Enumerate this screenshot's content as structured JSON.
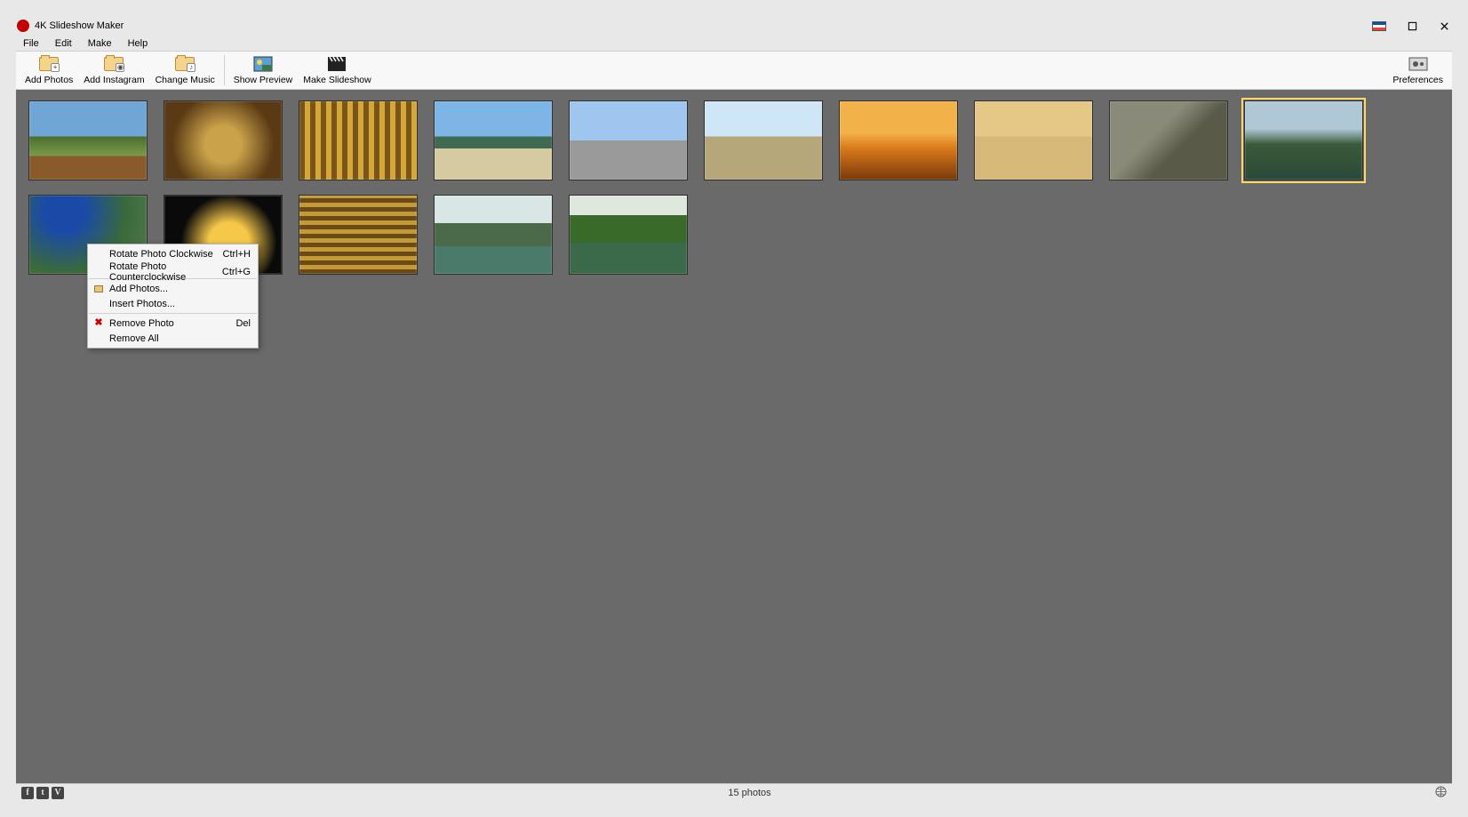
{
  "title": "4K Slideshow Maker",
  "menu": [
    "File",
    "Edit",
    "Make",
    "Help"
  ],
  "toolbar": {
    "add_photos": "Add Photos",
    "add_instagram": "Add Instagram",
    "change_music": "Change Music",
    "show_preview": "Show Preview",
    "make_slideshow": "Make Slideshow",
    "preferences": "Preferences"
  },
  "context_menu": {
    "rotate_cw": {
      "label": "Rotate Photo Clockwise",
      "shortcut": "Ctrl+H"
    },
    "rotate_ccw": {
      "label": "Rotate Photo Counterclockwise",
      "shortcut": "Ctrl+G"
    },
    "add_photos": {
      "label": "Add Photos...",
      "shortcut": ""
    },
    "insert_photos": {
      "label": "Insert Photos...",
      "shortcut": ""
    },
    "remove_photo": {
      "label": "Remove Photo",
      "shortcut": "Del"
    },
    "remove_all": {
      "label": "Remove All",
      "shortcut": ""
    }
  },
  "status": {
    "count_text": "15 photos"
  },
  "social": {
    "fb": "f",
    "tw": "t",
    "vi": "V"
  }
}
